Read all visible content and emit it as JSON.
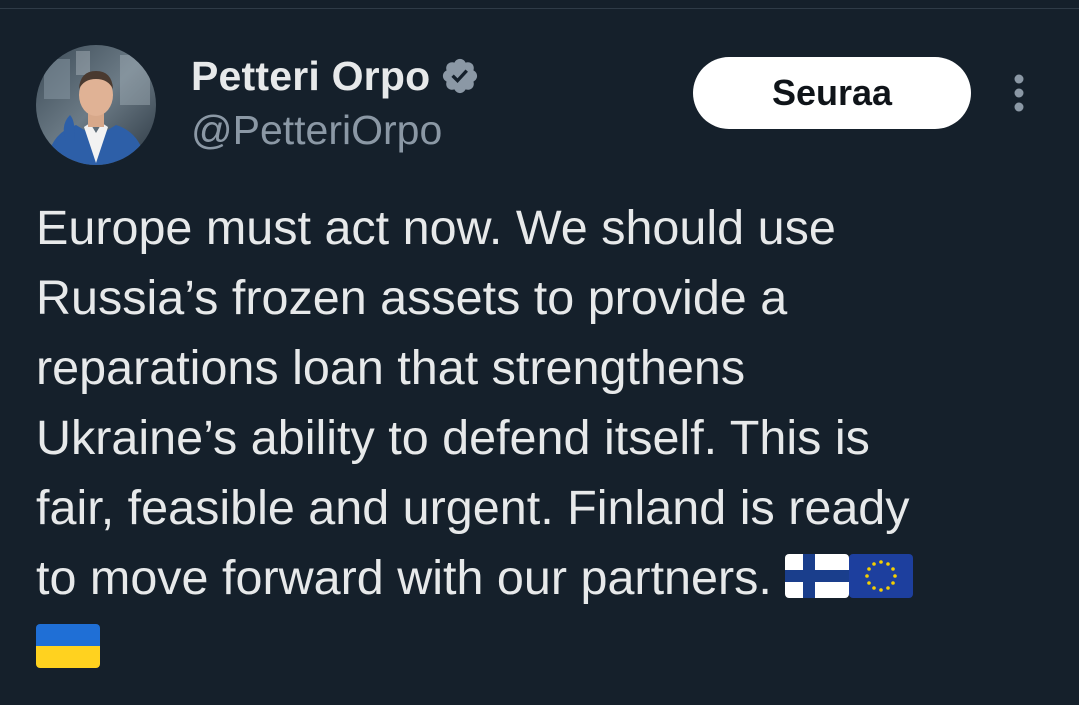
{
  "tweet": {
    "author": {
      "display_name": "Petteri Orpo",
      "handle": "@PetteriOrpo",
      "verified": true,
      "avatar_icon": "person-portrait-avatar"
    },
    "follow_label": "Seuraa",
    "more_icon": "vertical-ellipsis-icon",
    "text_lines": [
      "Europe must act now. We should use",
      "Russia’s frozen assets to provide a",
      "reparations loan that strengthens",
      "Ukraine’s ability to defend itself. This is",
      "fair, feasible and urgent. Finland is ready",
      "to move forward with our partners. "
    ],
    "flags": [
      "finland-flag",
      "eu-flag",
      "ukraine-flag"
    ]
  },
  "colors": {
    "background": "#15202b",
    "text": "#e7e9ea",
    "secondary_text": "#8b98a5",
    "button_bg": "#ffffff",
    "button_text": "#0f1419"
  }
}
